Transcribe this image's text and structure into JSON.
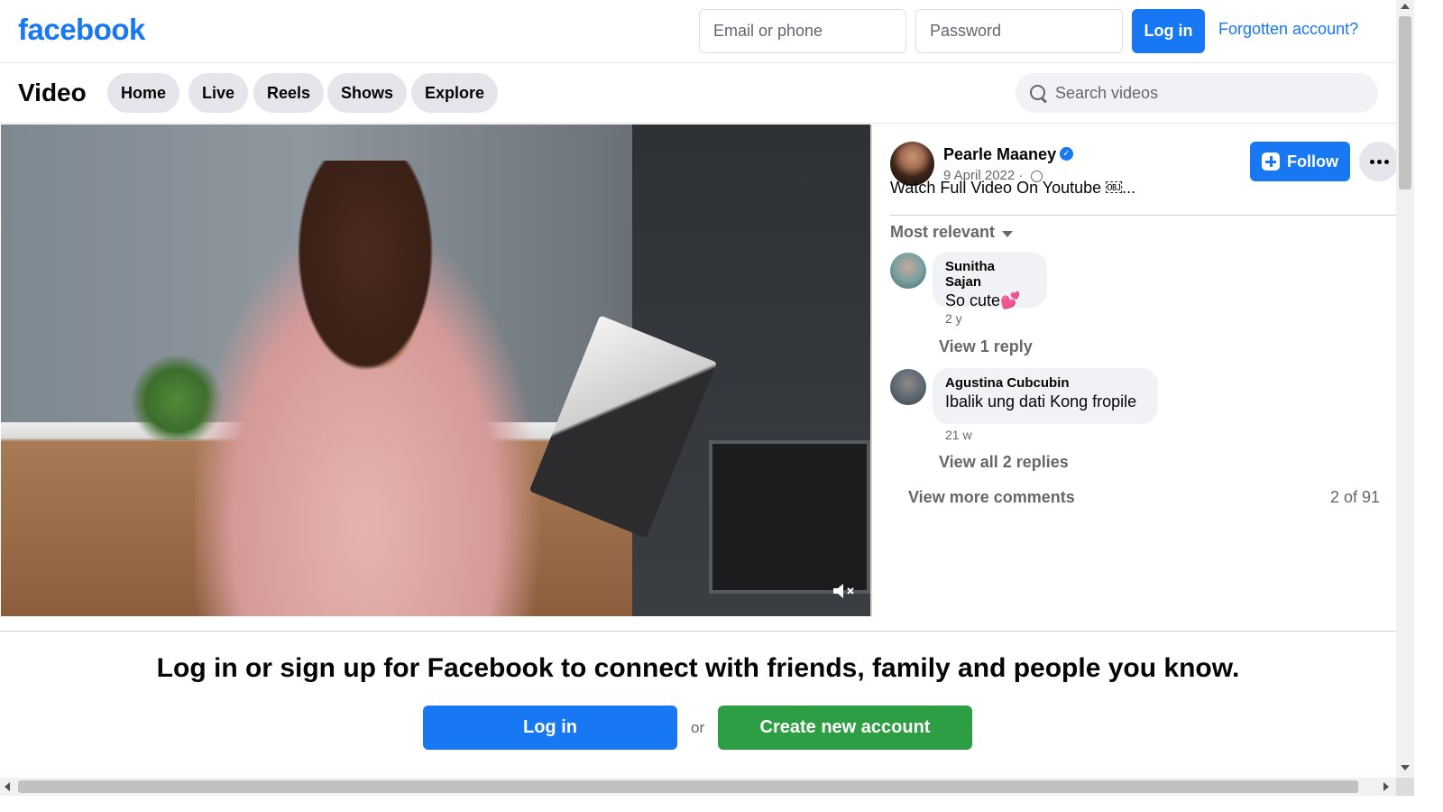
{
  "header": {
    "logo": "facebook",
    "email_placeholder": "Email or phone",
    "password_placeholder": "Password",
    "login_label": "Log in",
    "forgot_label": "Forgotten account?"
  },
  "subnav": {
    "title": "Video",
    "tabs": [
      {
        "label": "Home"
      },
      {
        "label": "Live"
      },
      {
        "label": "Reels"
      },
      {
        "label": "Shows"
      },
      {
        "label": "Explore"
      }
    ],
    "search_placeholder": "Search videos"
  },
  "post": {
    "author": "Pearle Maaney",
    "date": "9 April 2022 ·",
    "caption": "Watch Full Video On Youtube ￼...",
    "follow_label": "Follow"
  },
  "comments": {
    "sort_label": "Most relevant",
    "items": [
      {
        "name": "Sunitha Sajan",
        "text": "So cute💕",
        "time": "2 y",
        "reply_label": "View 1 reply"
      },
      {
        "name": "Agustina Cubcubin",
        "text": "Ibalik ung dati Kong fropile",
        "time": "21 w",
        "reply_label": "View all 2 replies"
      }
    ],
    "view_more_label": "View more comments",
    "count_label": "2 of 91"
  },
  "banner": {
    "title": "Log in or sign up for Facebook to connect with friends, family and people you know.",
    "login_label": "Log in",
    "or_label": "or",
    "create_label": "Create new account"
  },
  "colors": {
    "brand": "#1877f2",
    "create": "#2e9e45"
  }
}
